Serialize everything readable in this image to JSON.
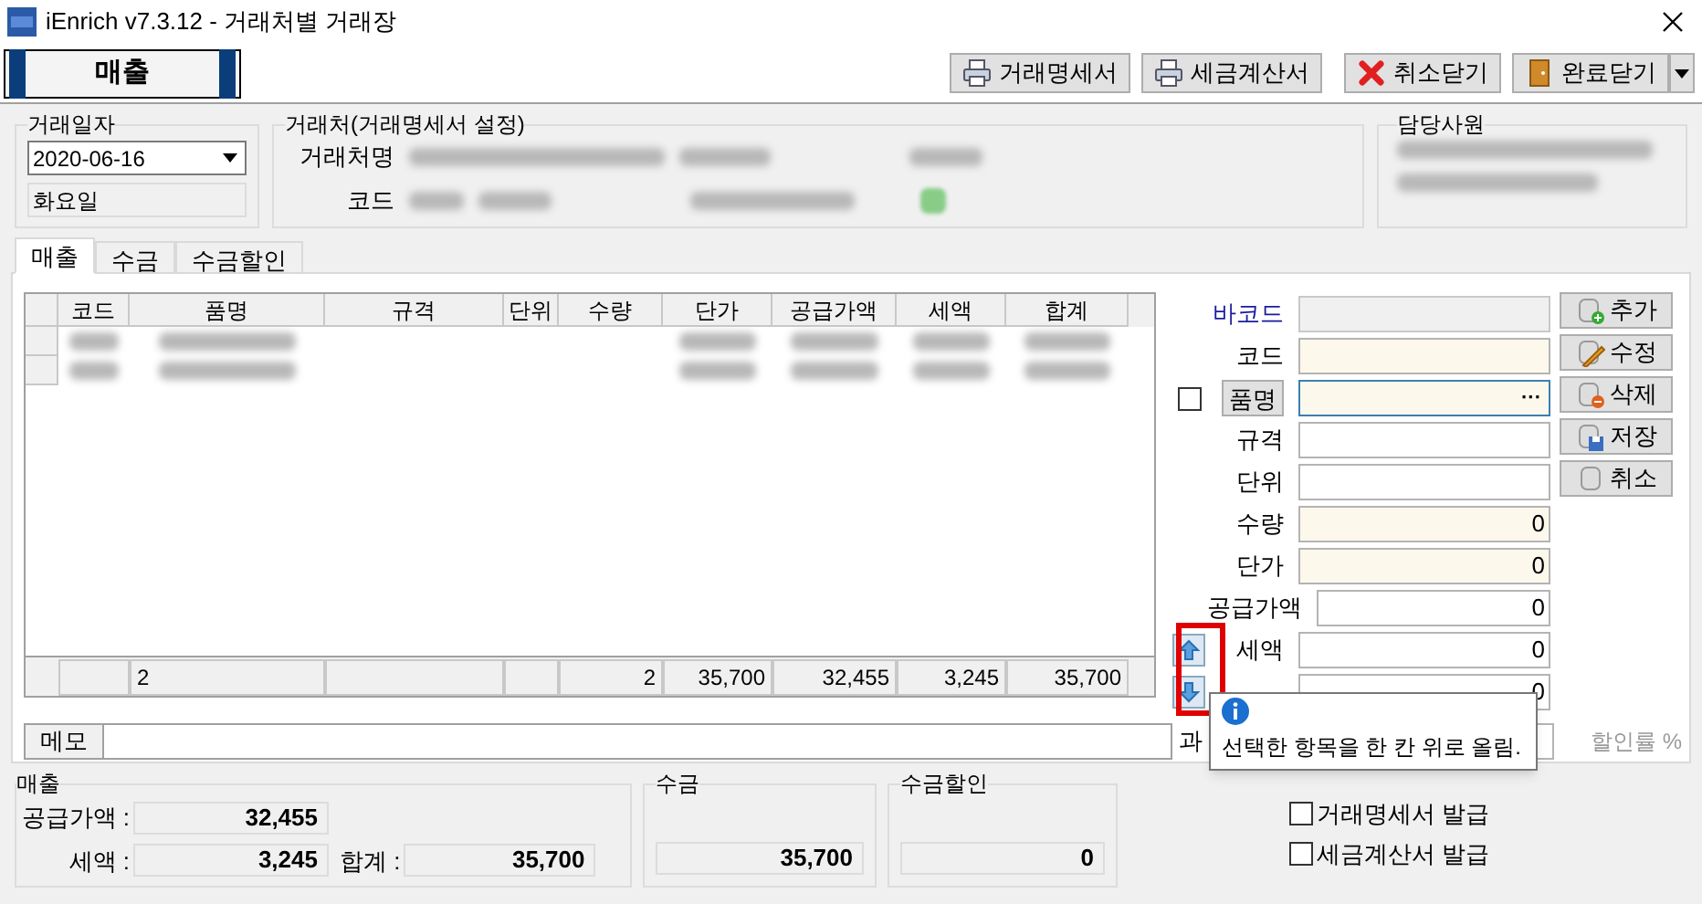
{
  "window": {
    "title": "iEnrich v7.3.12 - 거래처별 거래장"
  },
  "banner": "매출",
  "toolbar_buttons": [
    {
      "label": "거래명세서",
      "kind": "printer"
    },
    {
      "label": "세금계산서",
      "kind": "printer"
    },
    {
      "label": "취소닫기",
      "kind": "cross"
    },
    {
      "label": "완료닫기",
      "kind": "door"
    }
  ],
  "date_group": {
    "title": "거래일자",
    "date": "2020-06-16",
    "weekday": "화요일"
  },
  "customer_group": {
    "title": "거래처(거래명세서 설정)",
    "labels": [
      "거래처명",
      "코드"
    ]
  },
  "staff_group": {
    "title": "담당사원"
  },
  "tabs": [
    {
      "label": "매출",
      "selected": true
    },
    {
      "label": "수금",
      "selected": false
    },
    {
      "label": "수금할인",
      "selected": false
    }
  ],
  "table": {
    "columns": [
      "코드",
      "품명",
      "규격",
      "단위",
      "수량",
      "단가",
      "공급가액",
      "세액",
      "합계"
    ],
    "rows": [
      {
        "kind": "redacted"
      },
      {
        "kind": "redacted"
      }
    ],
    "footer": [
      {
        "kind": "empty"
      },
      {
        "kind": "text",
        "value": "2"
      },
      {
        "kind": "empty"
      },
      {
        "kind": "empty"
      },
      {
        "kind": "number",
        "value": "2"
      },
      {
        "kind": "number",
        "value": "35,700"
      },
      {
        "kind": "number",
        "value": "32,455"
      },
      {
        "kind": "number",
        "value": "3,245"
      },
      {
        "kind": "number",
        "value": "35,700"
      }
    ]
  },
  "form": [
    {
      "label": "바코드",
      "kind": "link",
      "input": {
        "kind": "readonly"
      }
    },
    {
      "label": "코드",
      "kind": "plain",
      "input": {
        "kind": "required"
      }
    },
    {
      "label": "품명",
      "kind": "button",
      "input": {
        "kind": "lookup"
      },
      "checkbox": {
        "checked": false
      },
      "ellipsis": "···"
    },
    {
      "label": "규격",
      "kind": "plain",
      "input": {
        "kind": "normal"
      }
    },
    {
      "label": "단위",
      "kind": "plain",
      "input": {
        "kind": "normal"
      }
    },
    {
      "label": "수량",
      "kind": "plain",
      "input": {
        "kind": "required"
      },
      "value": "0"
    },
    {
      "label": "단가",
      "kind": "plain",
      "input": {
        "kind": "required"
      },
      "value": "0"
    },
    {
      "label": "공급가액",
      "kind": "plain",
      "input": {
        "kind": "normal"
      },
      "value": "0"
    },
    {
      "label": "세액",
      "kind": "arrow-up",
      "input": {
        "kind": "normal"
      },
      "value": "0"
    },
    {
      "kind": "arrow-down",
      "input": {
        "kind": "normal"
      },
      "value": "0"
    }
  ],
  "side_buttons": [
    {
      "label": "추가",
      "kind": "add"
    },
    {
      "label": "수정",
      "kind": "edit"
    },
    {
      "label": "삭제",
      "kind": "delete"
    },
    {
      "label": "저장",
      "kind": "save"
    },
    {
      "label": "취소",
      "kind": "cancel"
    }
  ],
  "memo": {
    "label": "메모",
    "partial_label": "과",
    "rate_label": "할인률 %"
  },
  "tooltip": "선택한 항목을 한 칸 위로 올림.",
  "sales_group": {
    "title": "매출",
    "supply_label": "공급가액 :",
    "supply": "32,455",
    "tax_label": "세액 :",
    "tax": "3,245",
    "total_label": "합계 :",
    "total": "35,700"
  },
  "receipt_group": {
    "title": "수금",
    "value": "35,700"
  },
  "discount_group": {
    "title": "수금할인",
    "value": "0"
  },
  "checkboxes": [
    {
      "label": "거래명세서 발급",
      "checked": false
    },
    {
      "label": "세금계산서 발급",
      "checked": false
    }
  ]
}
